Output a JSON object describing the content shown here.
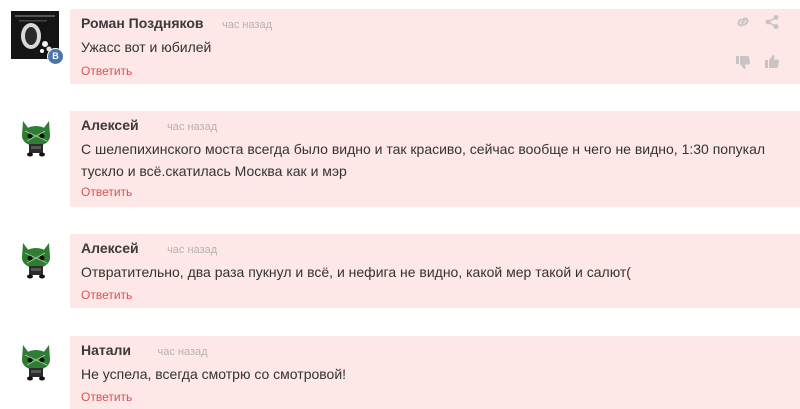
{
  "comments": [
    {
      "author": "Роман Поздняков",
      "time": "час назад",
      "text": "Ужасс вот и юбилей",
      "reply_label": "Ответить",
      "avatar_icon": "vk-profile-photo",
      "badge_label": "В"
    },
    {
      "author": "Алексей",
      "time": "час назад",
      "text": "С шелепихинского моста всегда было видно и так красиво, сейчас вообще н чего не видно, 1:30 попукал тускло и всё.скатилась Москва как и мэр",
      "reply_label": "Ответить",
      "avatar_icon": "green-cat-avatar"
    },
    {
      "author": "Алексей",
      "time": "час назад",
      "text": "Отвратительно, два раза пукнул и всё, и нефига не видно, какой мер такой и салют(",
      "reply_label": "Ответить",
      "avatar_icon": "green-cat-avatar"
    },
    {
      "author": "Натали",
      "time": "час назад",
      "text": "Не успела, всегда смотрю со смотровой!",
      "reply_label": "Ответить",
      "avatar_icon": "green-cat-avatar"
    }
  ],
  "toolbar_icons": [
    "link-icon",
    "share-icon",
    "thumbs-down-icon",
    "thumbs-up-icon"
  ],
  "colors": {
    "bubble_bg": "#fde7e7",
    "reply": "#d9534f",
    "author": "#3a3a3a",
    "time": "#b7b2b2",
    "icon": "#c9c4c4",
    "vk_badge": "#4a76a8",
    "cat_green": "#2e7d32"
  }
}
